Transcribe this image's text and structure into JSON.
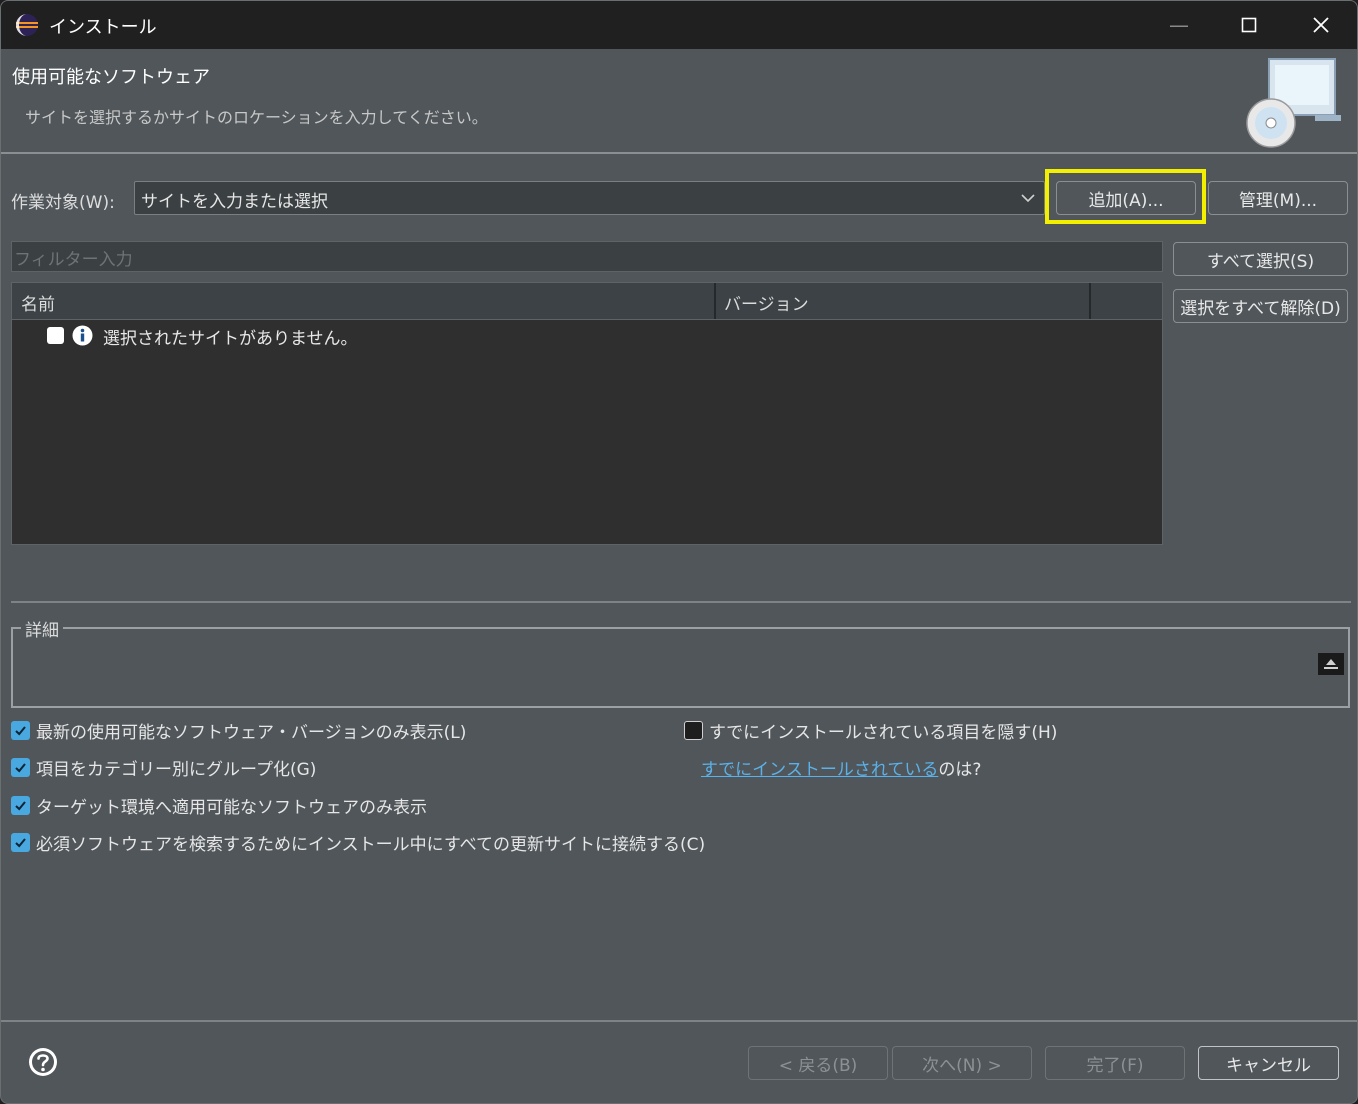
{
  "window": {
    "title": "インストール",
    "icon": "eclipse-icon"
  },
  "banner": {
    "title": "使用可能なソフトウェア",
    "subtitle": "サイトを選択するかサイトのロケーションを入力してください。",
    "icon": "computer-cd-icon"
  },
  "work_with": {
    "label": "作業対象(W):",
    "value": "サイトを入力または選択",
    "add_button": "追加(A)...",
    "manage_button": "管理(M)..."
  },
  "filter": {
    "placeholder": "フィルター入力"
  },
  "side_buttons": {
    "select_all": "すべて選択(S)",
    "deselect_all": "選択をすべて解除(D)"
  },
  "table": {
    "columns": [
      "名前",
      "バージョン"
    ],
    "rows": [
      {
        "text": "選択されたサイトがありません。",
        "icon": "info-icon",
        "checked": false
      }
    ]
  },
  "details": {
    "legend": "詳細"
  },
  "options": {
    "show_latest": {
      "label": "最新の使用可能なソフトウェア・バージョンのみ表示(L)",
      "checked": true
    },
    "group_by_category": {
      "label": "項目をカテゴリー別にグループ化(G)",
      "checked": true
    },
    "target_only": {
      "label": "ターゲット環境へ適用可能なソフトウェアのみ表示",
      "checked": true
    },
    "contact_all": {
      "label": "必須ソフトウェアを検索するためにインストール中にすべての更新サイトに接続する(C)",
      "checked": true
    },
    "hide_installed": {
      "label": "すでにインストールされている項目を隠す(H)",
      "checked": false
    },
    "already_installed_link": "すでにインストールされている",
    "already_installed_suffix": " のは?"
  },
  "footer": {
    "back": "< 戻る(B)",
    "next": "次へ(N) >",
    "finish": "完了(F)",
    "cancel": "キャンセル",
    "help_icon": "help-icon"
  },
  "colors": {
    "highlight": "#f2ef00",
    "checkbox_on": "#4aa8e0",
    "link": "#5bb2ea",
    "dialog_bg": "#50565a"
  }
}
